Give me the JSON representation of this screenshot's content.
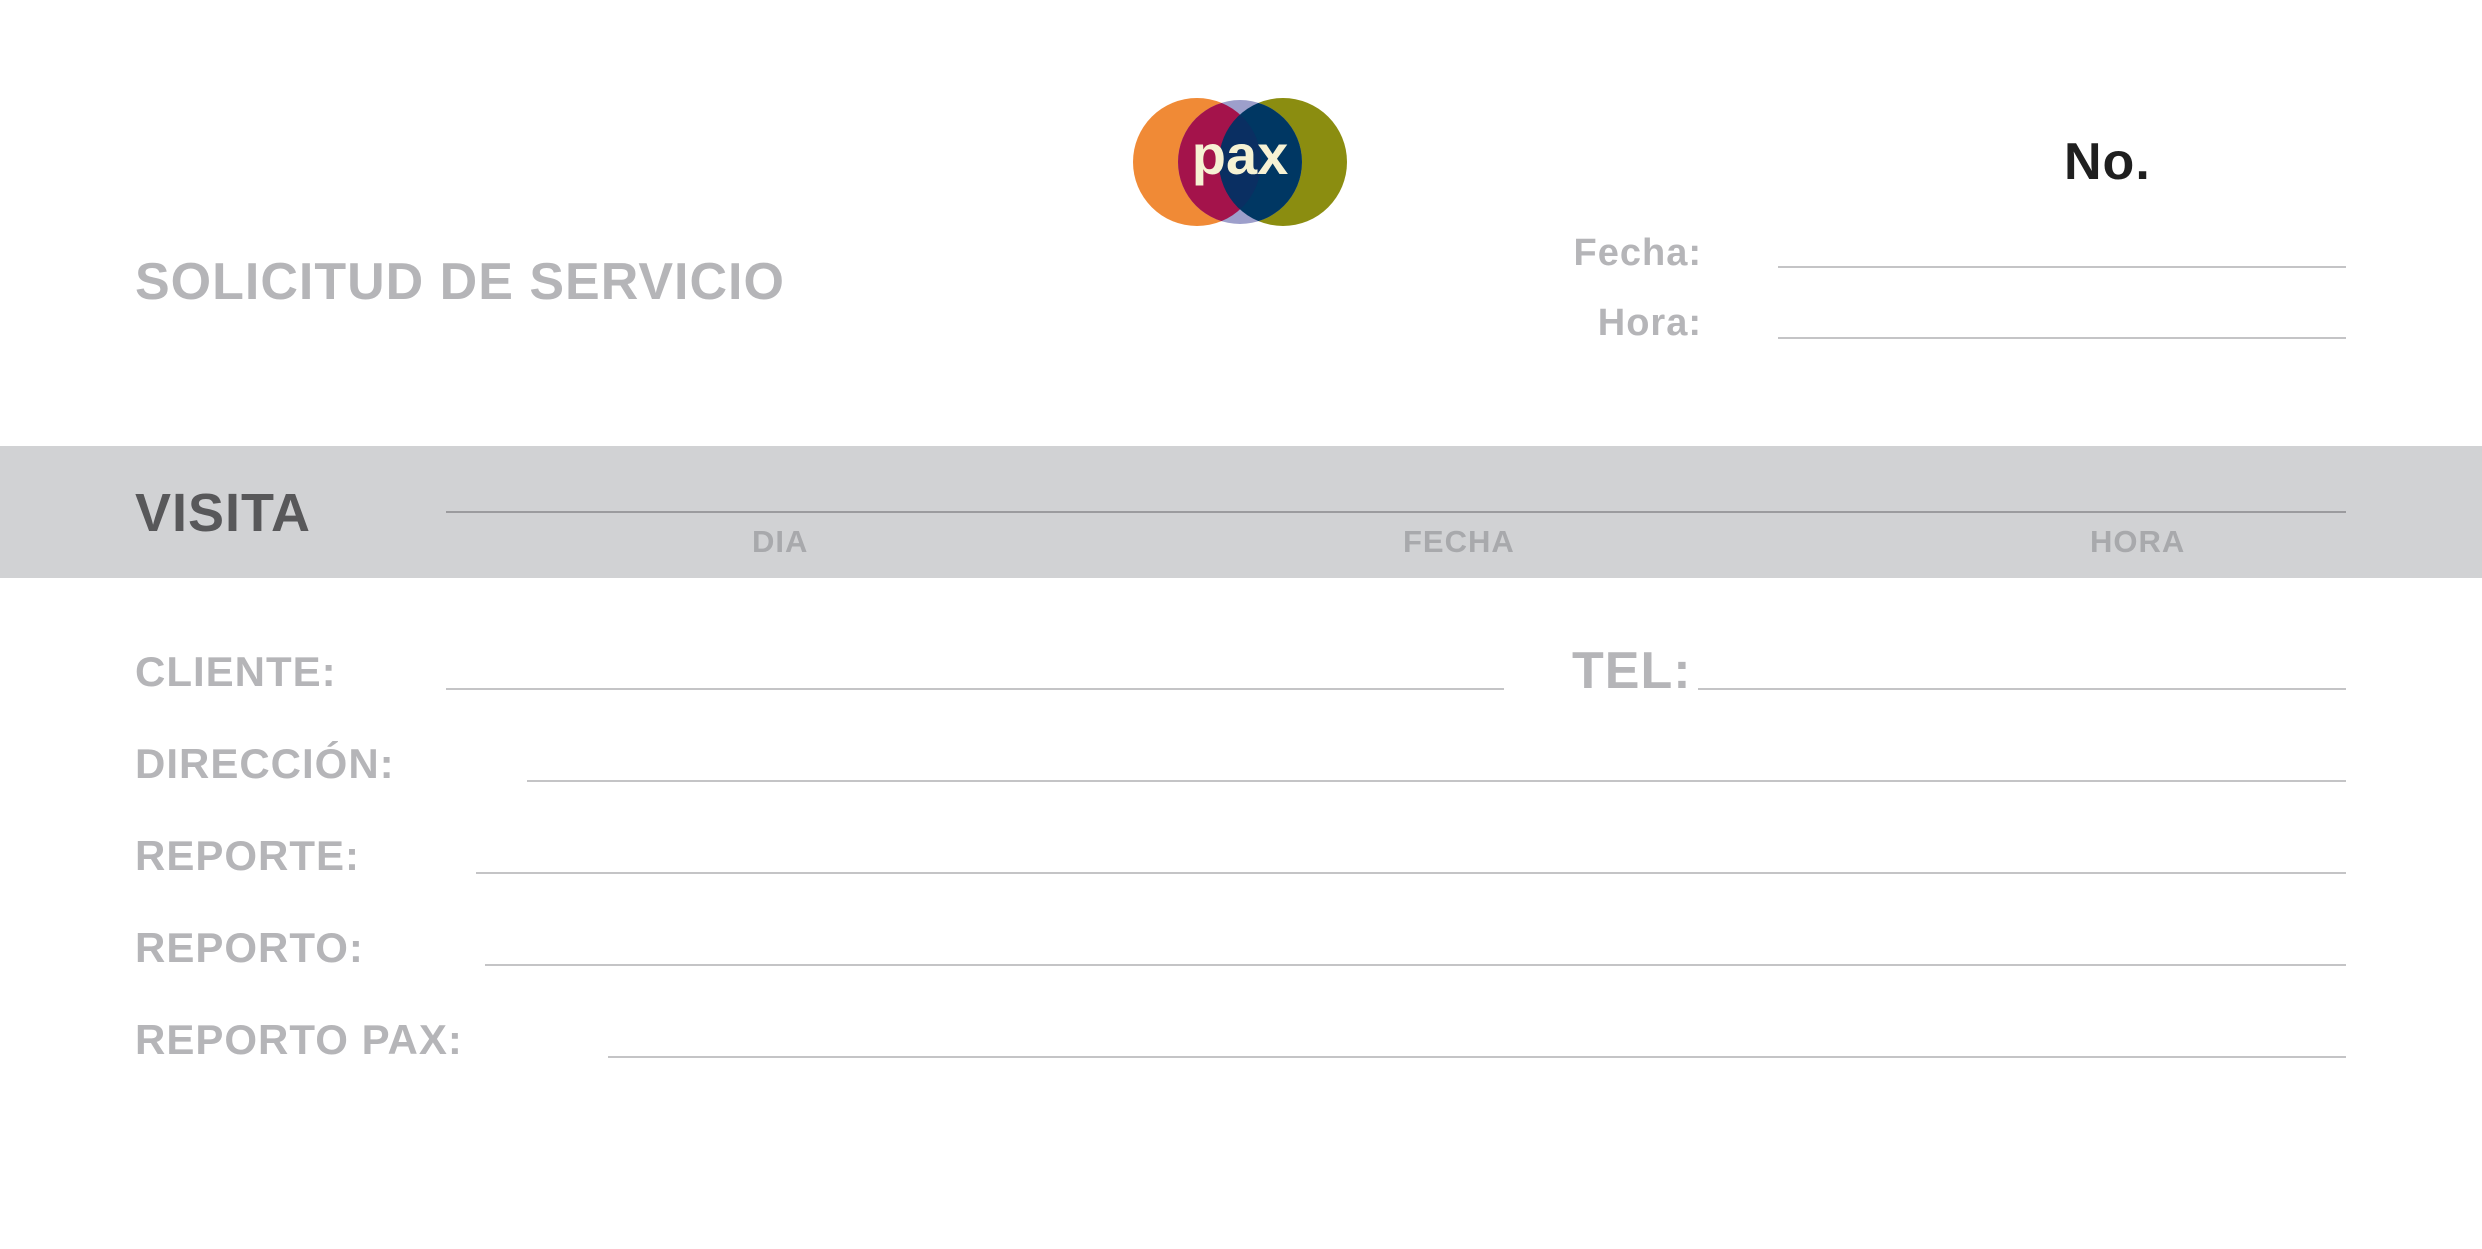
{
  "header": {
    "logo_text": "pax",
    "number_label": "No.",
    "title": "SOLICITUD DE SERVICIO",
    "fecha_label": "Fecha:",
    "hora_label": "Hora:"
  },
  "visita": {
    "label": "VISITA",
    "columns": [
      "DIA",
      "FECHA",
      "HORA"
    ]
  },
  "fields": {
    "cliente": "CLIENTE:",
    "tel": "TEL:",
    "direccion": "DIRECCIÓN:",
    "reporte": "REPORTE:",
    "reporto": "REPORTO:",
    "reporto_pax": "REPORTO PAX:"
  },
  "colors": {
    "logo_orange": "#f08a36",
    "logo_crimson": "#a4134b",
    "logo_lavender": "#9d9fcb",
    "logo_navy": "#003763",
    "logo_olive": "#8b8d10",
    "logo_text": "#f6f2d4",
    "band_gray": "#d1d2d4",
    "label_gray": "#b5b5b8"
  }
}
